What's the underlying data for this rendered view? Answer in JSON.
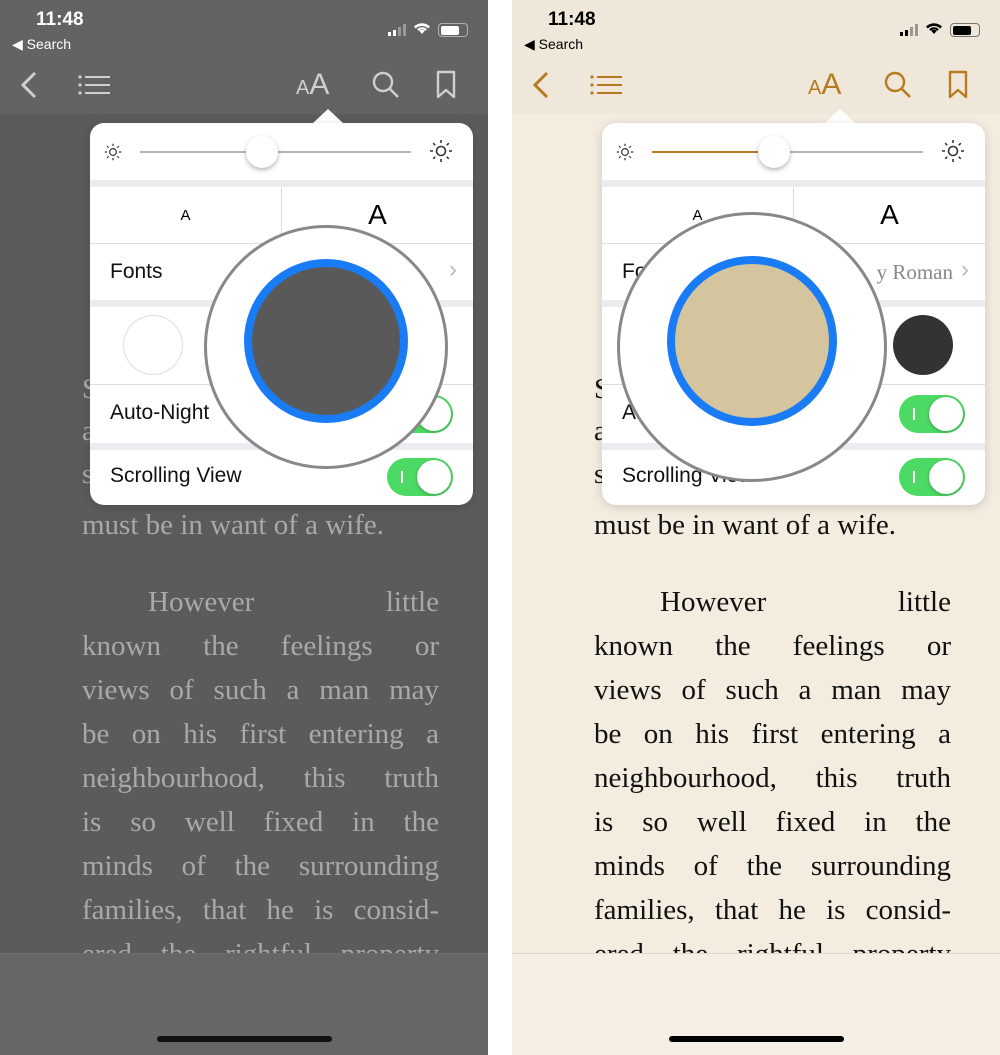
{
  "status": {
    "time": "11:48",
    "back_label": "◀ Search"
  },
  "toolbar": {
    "back_icon": "chevron-left-icon",
    "toc_icon": "list-icon",
    "text_size_label": "AA",
    "search_icon": "magnifier-icon",
    "bookmark_icon": "bookmark-icon"
  },
  "popover": {
    "brightness_low_icon": "sun-small-icon",
    "brightness_high_icon": "sun-large-icon",
    "smaller_label": "A",
    "larger_label": "A",
    "fonts_label": "Fonts",
    "auto_night_label": "Auto-Night Theme",
    "scrolling_label": "Scrolling View",
    "auto_night_on": true,
    "scrolling_on": true
  },
  "book": {
    "hidden_fragments": [
      "S",
      "a",
      "s"
    ],
    "lines": [
      "must be in want of a wife.",
      "However little",
      "known the feelings or",
      "views of such a man may",
      "be on his first entering a",
      "neighbourhood, this truth",
      "is so well fixed in the",
      "minds of the surrounding",
      "families, that he is consid-",
      "ered the rightful property"
    ]
  },
  "panels": [
    {
      "theme": "gray",
      "brightness": 0.45,
      "font_value": "",
      "selected_theme_color": "#595959",
      "visible_fonts_label": "Fonts",
      "visible_auto_label": "Auto-Night",
      "visible_scroll_label": "Scrolling View",
      "colors": {
        "header": "#636363",
        "body": "#5b5b5b",
        "text": "#a9a9a9",
        "icon": "#cfcfcf",
        "status": "#ffffff",
        "bottom": "#666666",
        "home": "#111111"
      }
    },
    {
      "theme": "sepia",
      "brightness": 0.45,
      "font_value": "y Roman",
      "selected_theme_color": "#d4c59f",
      "visible_fonts_label": "Fo",
      "visible_auto_label": "A",
      "visible_scroll_label": "Scrolling View",
      "colors": {
        "header": "#efe8da",
        "body": "#f3ecdf",
        "text": "#111111",
        "icon": "#b87a1f",
        "status": "#000000",
        "bottom": "#f5efe6",
        "home": "#000000",
        "slider_fill": "#b87a1f"
      }
    }
  ]
}
